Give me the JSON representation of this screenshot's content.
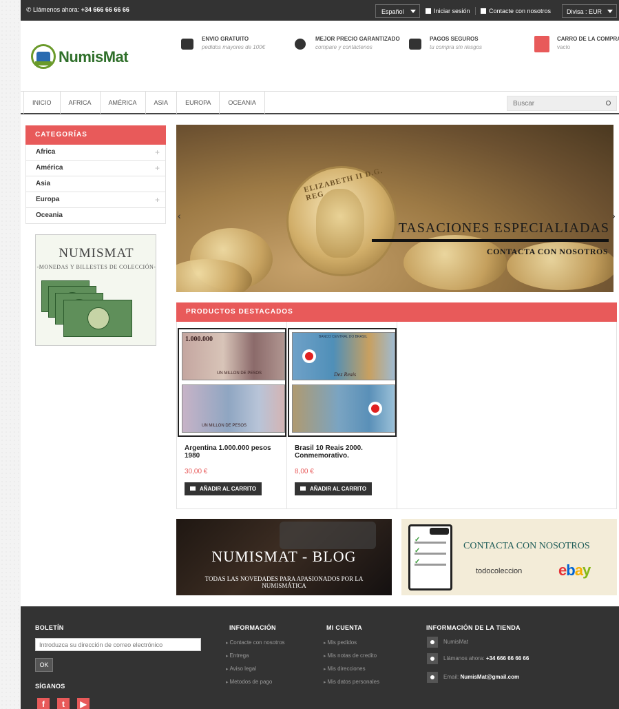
{
  "topbar": {
    "phone_label": "Llámenos ahora:",
    "phone_number": "+34 666 66 66 66",
    "language": "Español",
    "login": "Iniciar sesión",
    "contact": "Contacte con nosotros",
    "currency": "Divisa : EUR"
  },
  "brand": {
    "name": "NumisMat"
  },
  "features": [
    {
      "title": "ENVIO GRATUITO",
      "subtitle": "pedidos mayores de 100€",
      "icon": "truck-icon"
    },
    {
      "title": "MEJOR PRECIO GARANTIZADO",
      "subtitle": "compare y contáctenos",
      "icon": "globe-icon"
    },
    {
      "title": "PAGOS SEGUROS",
      "subtitle": "tu compra sin riesgos",
      "icon": "card-icon"
    }
  ],
  "cart": {
    "title": "CARRO DE LA COMPRA",
    "status": "vacío"
  },
  "nav": {
    "tabs": [
      "INICIO",
      "AFRICA",
      "AMÉRICA",
      "ASIA",
      "EUROPA",
      "OCEANIA"
    ]
  },
  "search": {
    "placeholder": "Buscar"
  },
  "categories": {
    "title": "CATEGORÍAS",
    "items": [
      "Africa",
      "América",
      "Asia",
      "Europa",
      "Oceania"
    ]
  },
  "promo": {
    "title": "NUMISMAT",
    "subtitle": "-MONEDAS Y BILLESTES DE COLECCIÓN-"
  },
  "slider": {
    "title": "TASACIONES ESPECIALIADAS",
    "subtitle": "CONTACTA CON NOSOTROS",
    "coin_text": "ELIZABETH II D.G. REG"
  },
  "featured": {
    "title": "PRODUCTOS DESTACADOS",
    "products": [
      {
        "name": "Argentina 1.000.000 pesos 1980",
        "price": "30,00 €",
        "button": "AÑADIR AL CARRITO",
        "note_top": "1.000.000",
        "note_label": "UN MILLON DE PESOS"
      },
      {
        "name": "Brasil 10 Reais 2000. Conmemorativo.",
        "price": "8,00 €",
        "button": "AÑADIR AL CARRITO",
        "note_top": "BANCO CENTRAL DO BRASIL",
        "note_label": "Dez Reais"
      }
    ]
  },
  "blog_banner": {
    "title": "NUMISMAT - BLOG",
    "subtitle": "TODAS LAS NOVEDADES PARA APASIONADOS POR LA NUMISMÁTICA"
  },
  "contact_banner": {
    "title": "CONTACTA CON NOSOTROS",
    "partner1": "todocoleccion",
    "partner2": "ebay"
  },
  "footer": {
    "newsletter_title": "BOLETÍN",
    "newsletter_placeholder": "Introduzca su dirección de correo electrónico",
    "ok": "OK",
    "follow": "SÍGANOS",
    "info_title": "INFORMACIÓN",
    "info_links": [
      "Contacte con nosotros",
      "Entrega",
      "Aviso legal",
      "Metodos de pago"
    ],
    "account_title": "MI CUENTA",
    "account_links": [
      "Mis pedidos",
      "Mis notas de credito",
      "Mis direcciones",
      "Mis datos personales"
    ],
    "store_title": "INFORMACIÓN DE LA TIENDA",
    "store_name": "NumisMat",
    "store_phone_label": "Llámanos ahora:",
    "store_phone": "+34 666 66 66 66",
    "store_email_label": "Email:",
    "store_email": "NumisMat@gmail.com"
  },
  "colors": {
    "accent": "#e85a5a",
    "dark": "#333333",
    "brand_green": "#2f6f2a"
  }
}
